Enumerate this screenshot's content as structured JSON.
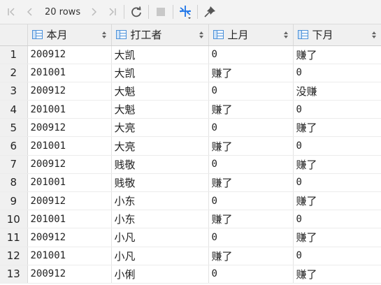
{
  "toolbar": {
    "first_icon": "first-page-icon",
    "prev_icon": "prev-page-icon",
    "rows_label": "20 rows",
    "next_icon": "next-page-icon",
    "last_icon": "last-page-icon",
    "refresh_icon": "refresh-icon",
    "stop_icon": "stop-icon",
    "transpose_icon": "transpose-icon",
    "pin_icon": "pin-icon",
    "accent": "#1a73e8"
  },
  "table": {
    "columns": [
      "本月",
      "打工者",
      "上月",
      "下月"
    ],
    "rows": [
      {
        "num": "1",
        "cells": [
          "200912",
          "大凯",
          "0",
          "赚了"
        ]
      },
      {
        "num": "2",
        "cells": [
          "201001",
          "大凯",
          "赚了",
          "0"
        ]
      },
      {
        "num": "3",
        "cells": [
          "200912",
          "大魁",
          "0",
          "没赚"
        ]
      },
      {
        "num": "4",
        "cells": [
          "201001",
          "大魁",
          "赚了",
          "0"
        ]
      },
      {
        "num": "5",
        "cells": [
          "200912",
          "大亮",
          "0",
          "赚了"
        ]
      },
      {
        "num": "6",
        "cells": [
          "201001",
          "大亮",
          "赚了",
          "0"
        ]
      },
      {
        "num": "7",
        "cells": [
          "200912",
          "贱敬",
          "0",
          "赚了"
        ]
      },
      {
        "num": "8",
        "cells": [
          "201001",
          "贱敬",
          "赚了",
          "0"
        ]
      },
      {
        "num": "9",
        "cells": [
          "200912",
          "小东",
          "0",
          "赚了"
        ]
      },
      {
        "num": "10",
        "cells": [
          "201001",
          "小东",
          "赚了",
          "0"
        ]
      },
      {
        "num": "11",
        "cells": [
          "200912",
          "小凡",
          "0",
          "赚了"
        ]
      },
      {
        "num": "12",
        "cells": [
          "201001",
          "小凡",
          "赚了",
          "0"
        ]
      },
      {
        "num": "13",
        "cells": [
          "200912",
          "小俐",
          "0",
          "赚了"
        ]
      }
    ]
  }
}
